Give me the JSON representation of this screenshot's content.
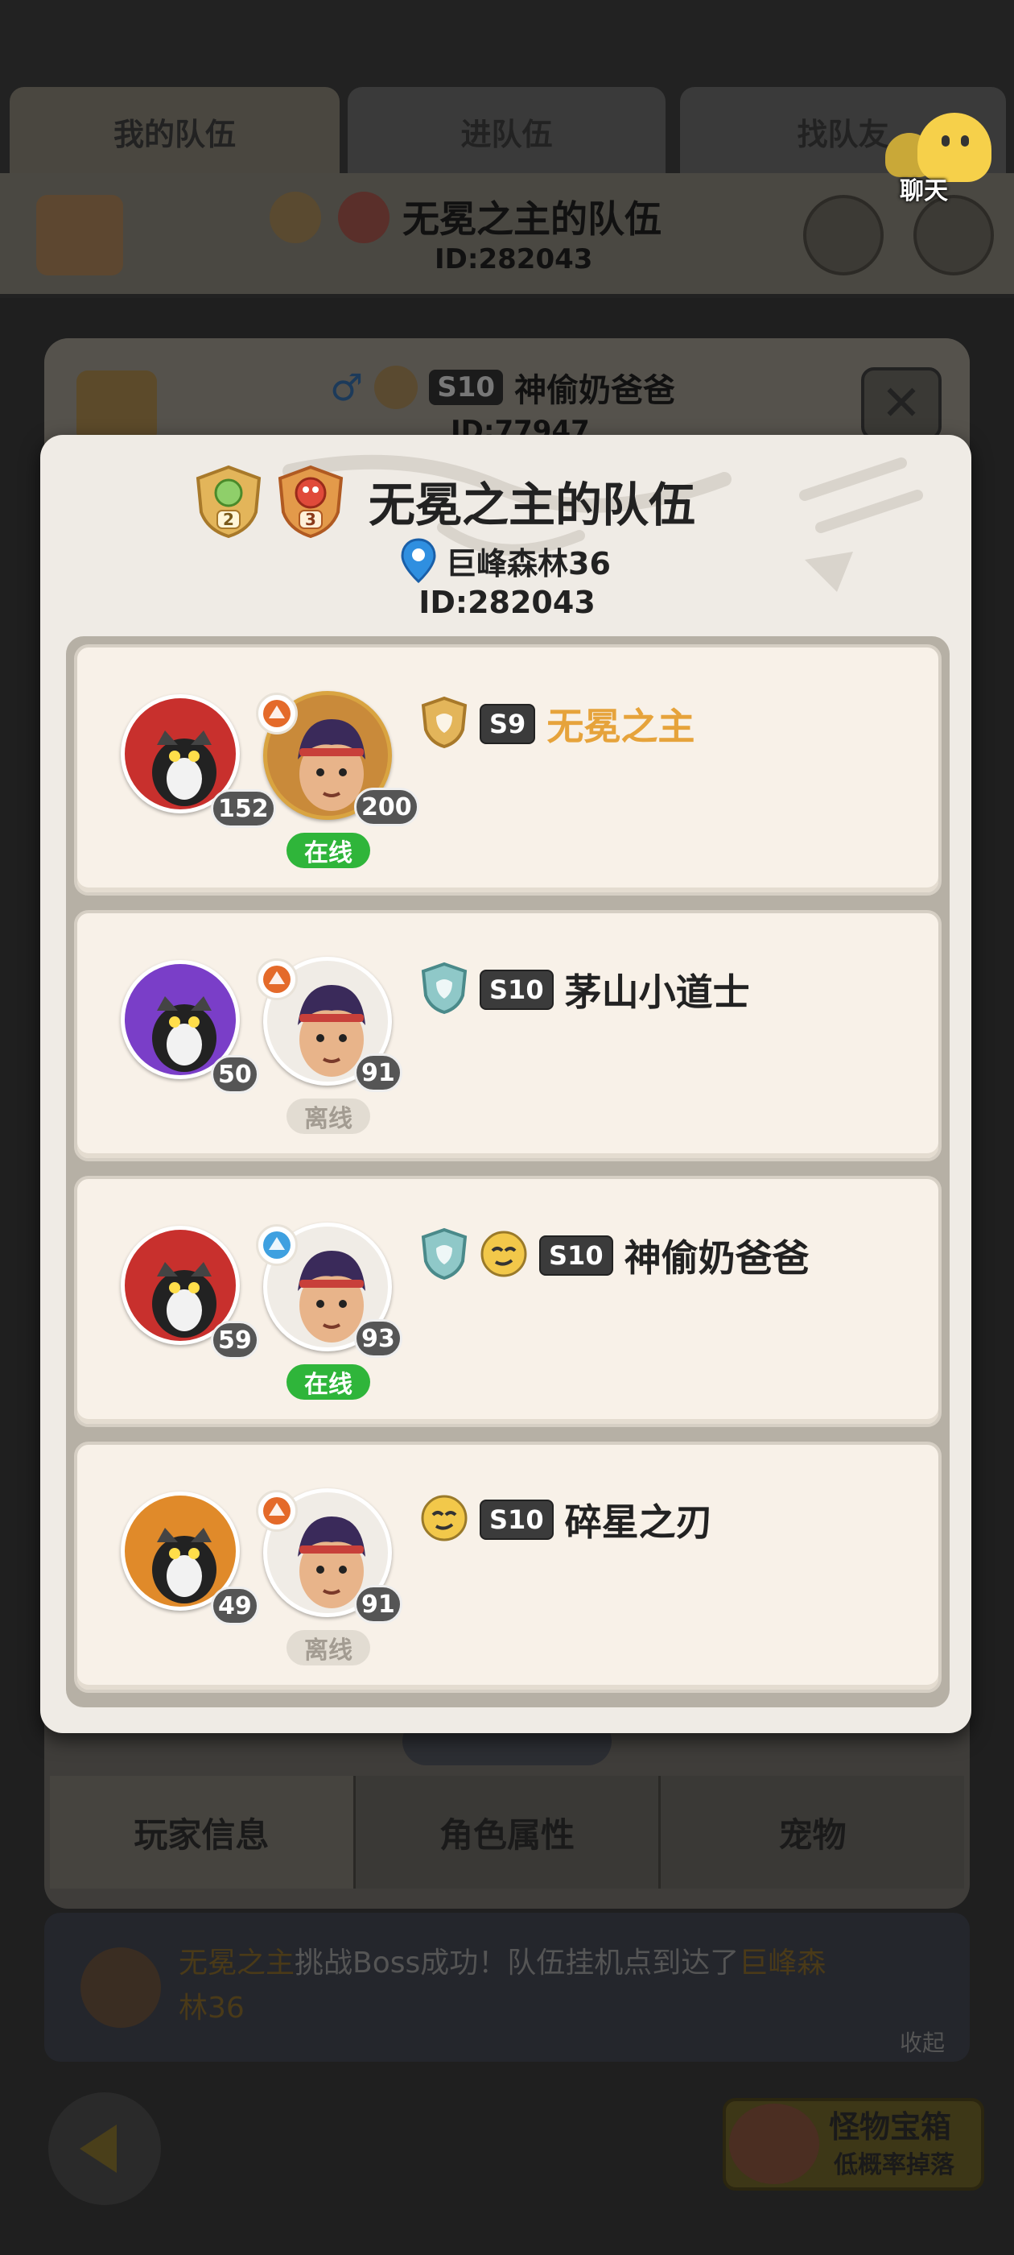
{
  "tabs": [
    "我的队伍",
    "进队伍",
    "找队友"
  ],
  "chat": {
    "label": "聊天"
  },
  "bg_header": {
    "team_title": "无冕之主的队伍",
    "team_id": "ID:282043"
  },
  "bg_profile": {
    "tier": "S10",
    "name": "神偷奶爸爸",
    "id_partial": "ID:77947"
  },
  "modal": {
    "rank_left": "2",
    "rank_right": "3",
    "title": "无冕之主的队伍",
    "location": "巨峰森林36",
    "team_id": "ID:282043",
    "members": [
      {
        "pet_level": "152",
        "hero_level": "200",
        "status": "在线",
        "online": true,
        "tier": "S9",
        "name": "无冕之主",
        "leader": true,
        "pet_color": "#c8302d",
        "class_color": "#e46a2a"
      },
      {
        "pet_level": "50",
        "hero_level": "91",
        "status": "离线",
        "online": false,
        "tier": "S10",
        "name": "茅山小道士",
        "leader": false,
        "pet_color": "#7a3ec8",
        "class_color": "#e46a2a"
      },
      {
        "pet_level": "59",
        "hero_level": "93",
        "status": "在线",
        "online": true,
        "tier": "S10",
        "name": "神偷奶爸爸",
        "leader": false,
        "pet_color": "#c8302d",
        "class_color": "#3ea0e0"
      },
      {
        "pet_level": "49",
        "hero_level": "91",
        "status": "离线",
        "online": false,
        "tier": "S10",
        "name": "碎星之刃",
        "leader": false,
        "pet_color": "#e08a2a",
        "class_color": "#e46a2a"
      }
    ]
  },
  "bottom_tabs": [
    "玩家信息",
    "角色属性",
    "宠物"
  ],
  "news": {
    "actor": "无冕之主",
    "text_a": "挑战Boss成功！队伍挂机点到达了",
    "place_a": "巨峰森",
    "place_b": "林36",
    "fold": "收起"
  },
  "chest": {
    "title": "怪物宝箱",
    "subtitle": "低概率掉落"
  }
}
